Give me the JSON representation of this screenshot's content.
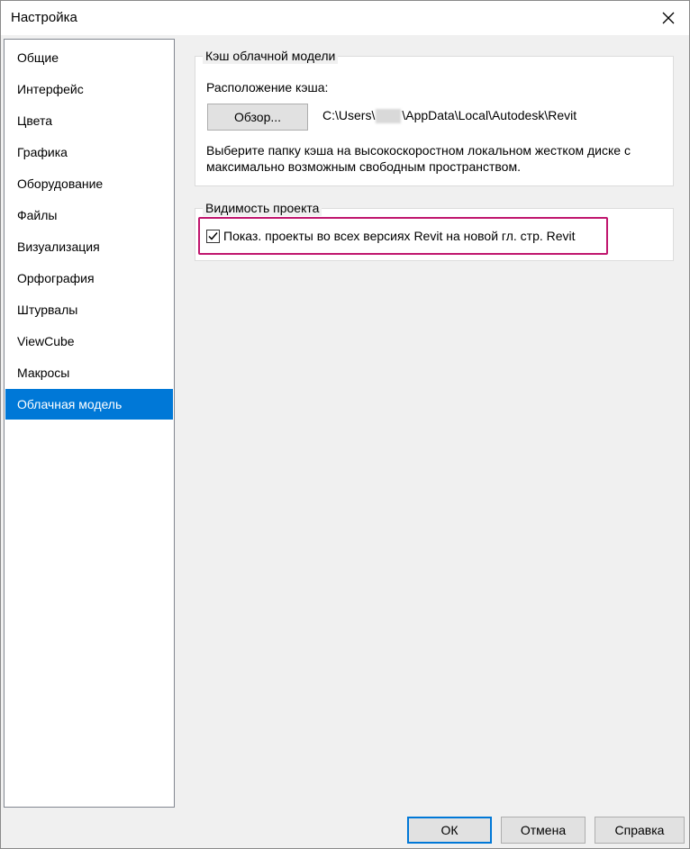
{
  "window": {
    "title": "Настройка"
  },
  "sidebar": {
    "items": [
      {
        "label": "Общие"
      },
      {
        "label": "Интерфейс"
      },
      {
        "label": "Цвета"
      },
      {
        "label": "Графика"
      },
      {
        "label": "Оборудование"
      },
      {
        "label": "Файлы"
      },
      {
        "label": "Визуализация"
      },
      {
        "label": "Орфография"
      },
      {
        "label": "Штурвалы"
      },
      {
        "label": "ViewCube"
      },
      {
        "label": "Макросы"
      },
      {
        "label": "Облачная модель"
      }
    ],
    "selected_index": 11
  },
  "cache_group": {
    "title": "Кэш облачной модели",
    "location_label": "Расположение кэша:",
    "browse_label": "Обзор...",
    "path_prefix": "C:\\Users\\",
    "path_suffix": "\\AppData\\Local\\Autodesk\\Revit",
    "hint_line1": "Выберите папку кэша на высокоскоростном локальном жестком диске с",
    "hint_line2": "максимально возможным свободным пространством."
  },
  "visibility_group": {
    "title": "Видимость проекта",
    "checkbox_label": "Показ. проекты во всех версиях Revit на новой гл. стр. Revit",
    "checked": true
  },
  "footer": {
    "ok_label": "ОК",
    "cancel_label": "Отмена",
    "help_label": "Справка"
  },
  "colors": {
    "selection": "#0078d7",
    "highlight_frame": "#c0166e"
  }
}
